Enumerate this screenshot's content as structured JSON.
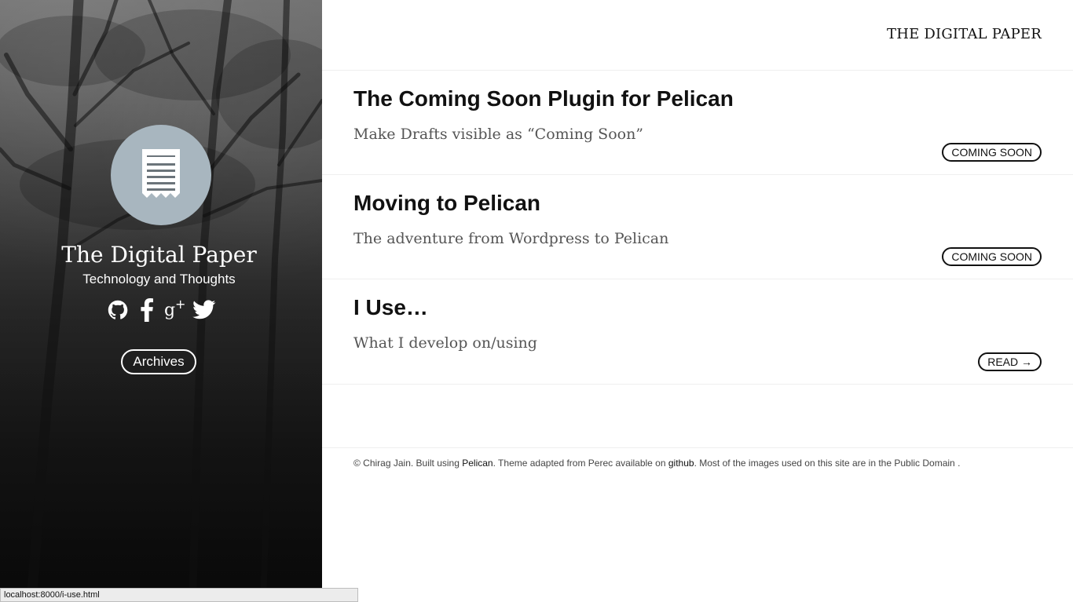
{
  "sidebar": {
    "title": "The Digital Paper",
    "subtitle": "Technology and Thoughts",
    "archives_label": "Archives",
    "avatar_icon": "receipt-icon",
    "social_icons": [
      "github-icon",
      "facebook-icon",
      "google-plus-icon",
      "twitter-icon"
    ]
  },
  "header": {
    "brand": "THE DIGITAL PAPER"
  },
  "posts": [
    {
      "title": "The Coming Soon Plugin for Pelican",
      "summary": "Make Drafts visible as “Coming Soon”",
      "action": "COMING SOON"
    },
    {
      "title": "Moving to Pelican",
      "summary": "The adventure from Wordpress to Pelican",
      "action": "COMING SOON"
    },
    {
      "title": "I Use…",
      "summary": "What I develop on/using",
      "action": "READ →"
    }
  ],
  "footer": {
    "prefix": "© Chirag Jain. Built using ",
    "pelican_link": "Pelican",
    "middle": ". Theme adapted from Perec available on ",
    "github_link": "github",
    "suffix": ". Most of the images used on this site are in the Public Domain ."
  },
  "browser": {
    "status_url": "localhost:8000/i-use.html"
  },
  "colors": {
    "sidebar_text": "#ffffff",
    "main_text": "#111111",
    "summary_text": "#555555",
    "divider": "#efefef",
    "avatar_bg": "#a8b6bf"
  }
}
